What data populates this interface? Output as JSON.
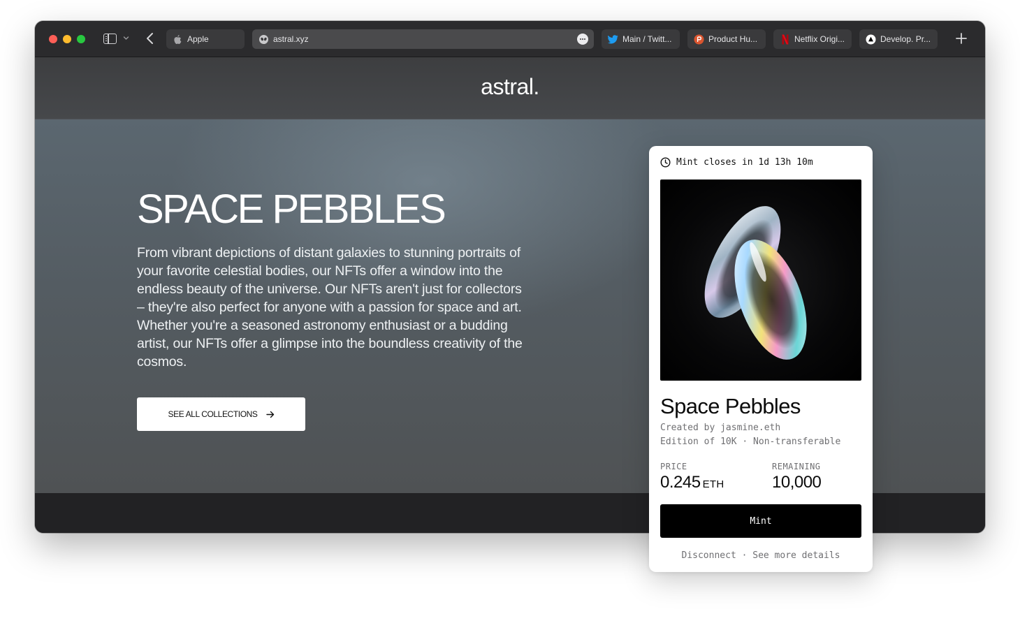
{
  "browser": {
    "tabs": [
      {
        "label": "Apple",
        "icon": "apple-icon"
      },
      {
        "label": "astral.xyz",
        "icon": "alien-icon",
        "active": true
      },
      {
        "label": "Main / Twitt...",
        "icon": "twitter-icon"
      },
      {
        "label": "Product Hu...",
        "icon": "product-hunt-icon"
      },
      {
        "label": "Netflix Origi...",
        "icon": "netflix-icon"
      },
      {
        "label": "Develop. Pr...",
        "icon": "vercel-icon"
      }
    ]
  },
  "site": {
    "logo": "astral."
  },
  "hero": {
    "title": "SPACE PEBBLES",
    "description": "From vibrant depictions of distant galaxies to stunning portraits of your favorite celestial bodies, our NFTs offer a window into the endless beauty of the universe. Our NFTs aren't just for collectors – they're also perfect for anyone with a passion for space and art. Whether you're a seasoned astronomy enthusiast or a budding artist, our NFTs offer a glimpse into the boundless creativity of the cosmos.",
    "cta_label": "SEE ALL COLLECTIONS"
  },
  "mint_card": {
    "countdown": "Mint closes in 1d 13h 10m",
    "title": "Space Pebbles",
    "creator": "Created by jasmine.eth",
    "edition": "Edition of 10K  ·  Non-transferable",
    "price_label": "PRICE",
    "price_value": "0.245",
    "price_unit": "ETH",
    "remaining_label": "REMAINING",
    "remaining_value": "10,000",
    "mint_label": "Mint",
    "links": "Disconnect · See more details"
  },
  "colors": {
    "mint_button": "#000000",
    "card_background": "#ffffff",
    "hero_background": "#545c62"
  }
}
